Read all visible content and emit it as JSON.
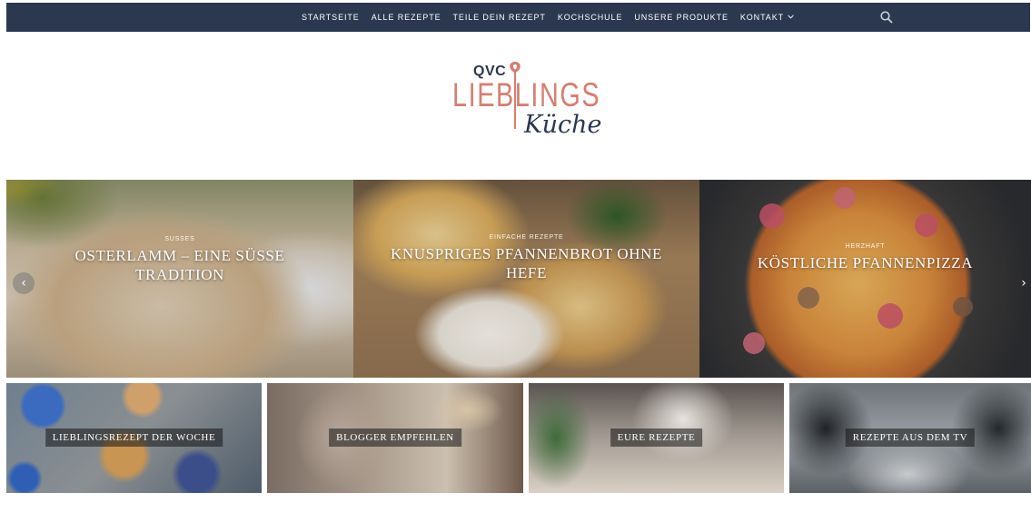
{
  "nav": {
    "items": [
      {
        "label": "STARTSEITE"
      },
      {
        "label": "ALLE REZEPTE"
      },
      {
        "label": "TEILE DEIN REZEPT"
      },
      {
        "label": "KOCHSCHULE"
      },
      {
        "label": "UNSERE PRODUKTE"
      },
      {
        "label": "KONTAKT"
      }
    ],
    "search_icon": "search-icon",
    "dropdown_icon": "chevron-down-icon",
    "background_color": "#2b3850"
  },
  "logo": {
    "qvc": "QVC",
    "lieblings": "LIEBLINGS",
    "kuche": "Küche",
    "primary_color": "#2b3850",
    "accent_color": "#d77e70"
  },
  "slider": {
    "slides": [
      {
        "category": "Süßes",
        "title": "OSTERLAMM – EINE SÜSSE TRADITION"
      },
      {
        "category": "Einfache Rezepte",
        "title": "KNUSPRIGES PFANNENBROT OHNE HEFE"
      },
      {
        "category": "Herzhaft",
        "title": "KÖSTLICHE PFANNENPIZZA"
      }
    ],
    "prev_label": "‹",
    "next_label": "›"
  },
  "tiles": [
    {
      "label": "LIEBLINGSREZEPT DER WOCHE"
    },
    {
      "label": "BLOGGER EMPFEHLEN"
    },
    {
      "label": "EURE REZEPTE"
    },
    {
      "label": "REZEPTE AUS DEM TV"
    }
  ]
}
